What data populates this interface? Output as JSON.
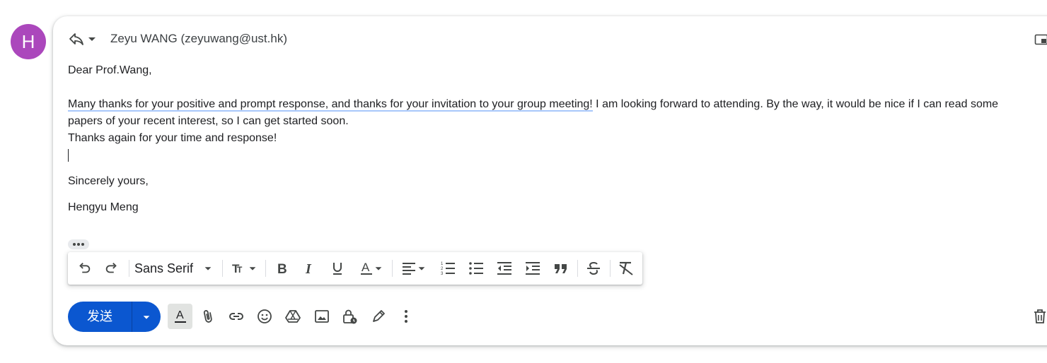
{
  "avatar": {
    "letter": "H",
    "color": "#ab47bc"
  },
  "header": {
    "reply_icon": "reply-icon",
    "dropdown_icon": "arrow-drop-down-icon",
    "recipient": "Zeyu WANG (zeyuwang@ust.hk)",
    "popout_icon": "popout-icon"
  },
  "message": {
    "greeting": "Dear Prof.Wang,",
    "line1_underlined": "Many thanks for your positive and prompt response, and thanks for your invitation to your group meeting!",
    "line1_rest": " I am looking forward to attending. By the way, it would be nice if I can read some papers of your recent interest, so I can get started soon.",
    "line2": "Thanks again for your time and response!",
    "closing": "Sincerely yours,",
    "signature": "Hengyu Meng"
  },
  "formatting": {
    "font": "Sans Serif",
    "tools": [
      "undo-icon",
      "redo-icon",
      "font-size-icon",
      "bold-icon",
      "italic-icon",
      "underline-icon",
      "text-color-icon",
      "align-icon",
      "numbered-list-icon",
      "bulleted-list-icon",
      "indent-less-icon",
      "indent-more-icon",
      "quote-icon",
      "strikethrough-icon",
      "remove-formatting-icon"
    ]
  },
  "compose": {
    "send_label": "发送",
    "accent": "#0b57d0",
    "tools": [
      "formatting-options-icon",
      "attach-icon",
      "link-icon",
      "emoji-icon",
      "drive-icon",
      "photo-icon",
      "confidential-mode-icon",
      "signature-icon",
      "more-options-icon",
      "discard-icon"
    ]
  }
}
